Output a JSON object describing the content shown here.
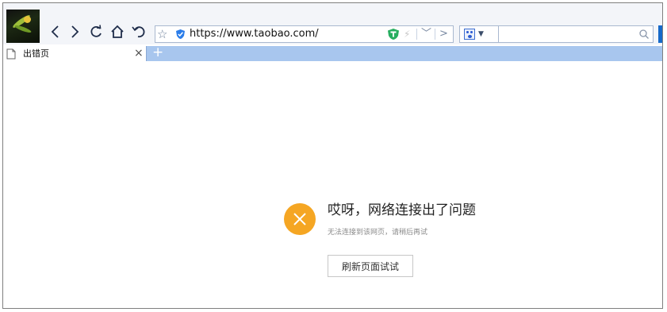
{
  "browser": {
    "url": "https://www.taobao.com/",
    "tab": {
      "label": "出错页"
    },
    "new_tab_symbol": "+",
    "tab_close_symbol": "×"
  },
  "error": {
    "title": "哎呀，网络连接出了问题",
    "subtitle": "无法连接到该网页，请稍后再试",
    "refresh_button": "刷新页面试试"
  },
  "colors": {
    "tab_bar": "#a8c6ee",
    "error_icon": "#f5a623",
    "security_shield": "#2b7de9",
    "extension_shield": "#27ae60"
  },
  "icons": [
    "back-icon",
    "forward-icon",
    "refresh-icon",
    "home-icon",
    "undo-icon",
    "star-icon",
    "shield-icon",
    "ext-shield-icon",
    "bolt-icon",
    "search-icon",
    "page-icon",
    "close-icon"
  ]
}
